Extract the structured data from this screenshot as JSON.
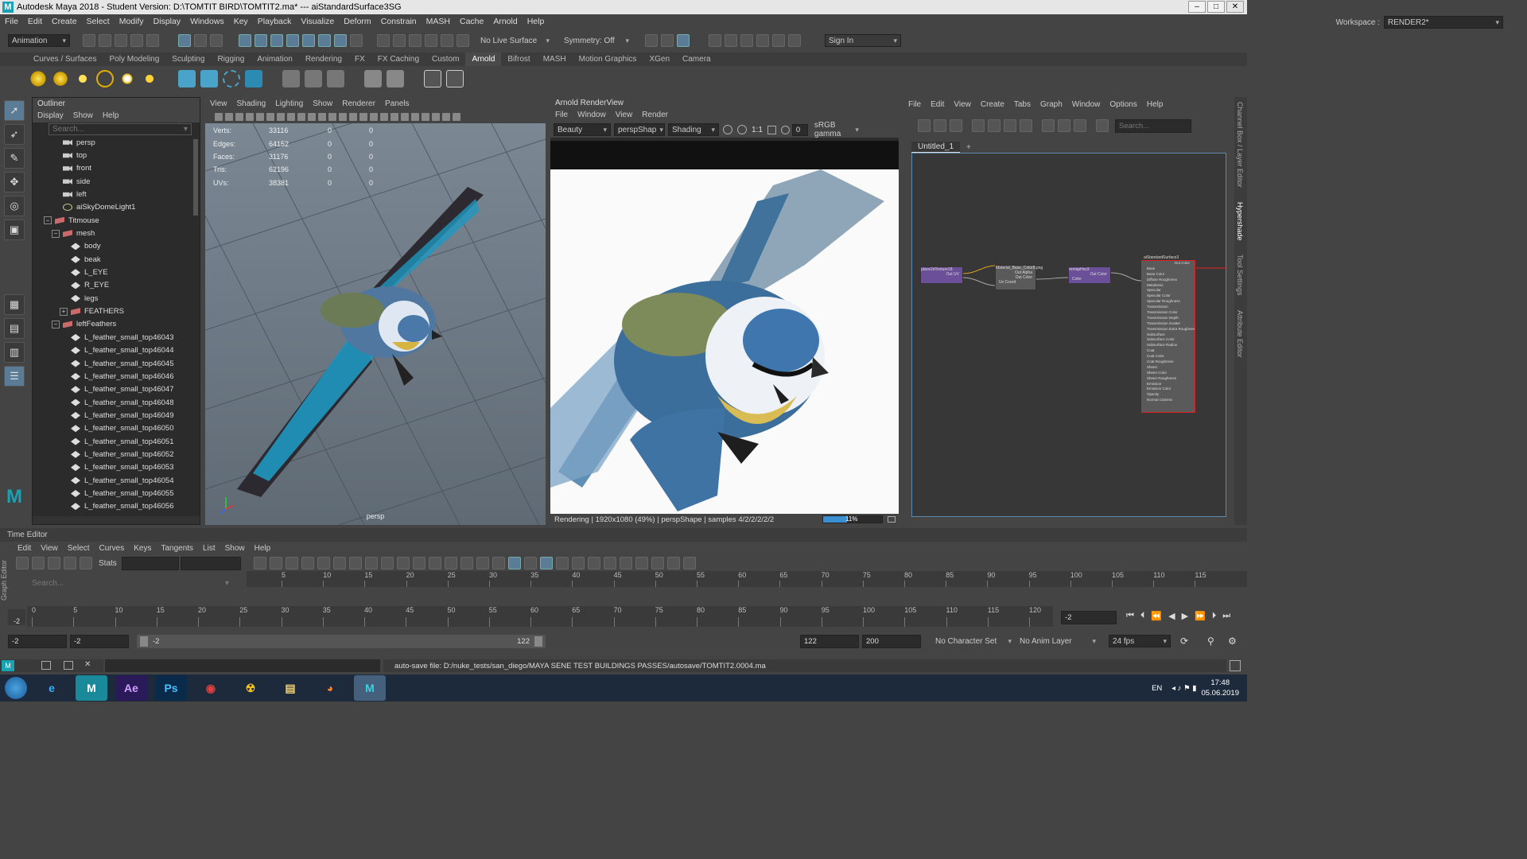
{
  "window": {
    "title": "Autodesk Maya 2018 - Student Version: D:\\TOMTIT BIRD\\TOMTIT2.ma*   ---   aiStandardSurface3SG",
    "min": "–",
    "max": "□",
    "close": "✕"
  },
  "menubar": [
    "File",
    "Edit",
    "Create",
    "Select",
    "Modify",
    "Display",
    "Windows",
    "Key",
    "Playback",
    "Visualize",
    "Deform",
    "Constrain",
    "MASH",
    "Cache",
    "Arnold",
    "Help"
  ],
  "workspace": {
    "label": "Workspace :",
    "value": "RENDER2*"
  },
  "statusline": {
    "mode": "Animation",
    "live_surface": "No Live Surface",
    "symmetry": "Symmetry: Off",
    "sign_in": "Sign In"
  },
  "shelf_tabs": [
    "Curves / Surfaces",
    "Poly Modeling",
    "Sculpting",
    "Rigging",
    "Animation",
    "Rendering",
    "FX",
    "FX Caching",
    "Custom",
    "Arnold",
    "Bifrost",
    "MASH",
    "Motion Graphics",
    "XGen",
    "Camera"
  ],
  "shelf_active": "Arnold",
  "outliner": {
    "title": "Outliner",
    "menu": [
      "Display",
      "Show",
      "Help"
    ],
    "search_placeholder": "Search...",
    "rows": [
      {
        "label": "persp",
        "icon": "camera-icon",
        "indent": 24
      },
      {
        "label": "top",
        "icon": "camera-icon",
        "indent": 24
      },
      {
        "label": "front",
        "icon": "camera-icon",
        "indent": 24
      },
      {
        "label": "side",
        "icon": "camera-icon",
        "indent": 24
      },
      {
        "label": "left",
        "icon": "camera-icon",
        "indent": 24
      },
      {
        "label": "aiSkyDomeLight1",
        "icon": "light-icon",
        "indent": 24
      },
      {
        "label": "Titmouse",
        "icon": "group-icon",
        "indent": 14,
        "exp": "−"
      },
      {
        "label": "mesh",
        "icon": "group-icon",
        "indent": 24,
        "exp": "−"
      },
      {
        "label": "body",
        "icon": "mesh-icon",
        "indent": 34
      },
      {
        "label": "beak",
        "icon": "mesh-icon",
        "indent": 34
      },
      {
        "label": "L_EYE",
        "icon": "mesh-icon",
        "indent": 34
      },
      {
        "label": "R_EYE",
        "icon": "mesh-icon",
        "indent": 34
      },
      {
        "label": "legs",
        "icon": "mesh-icon",
        "indent": 34
      },
      {
        "label": "FEATHERS",
        "icon": "group-icon",
        "indent": 34,
        "exp": "+"
      },
      {
        "label": "leftFeathers",
        "icon": "group-icon",
        "indent": 24,
        "exp": "−"
      },
      {
        "label": "L_feather_small_top46043",
        "icon": "mesh-icon",
        "indent": 34
      },
      {
        "label": "L_feather_small_top46044",
        "icon": "mesh-icon",
        "indent": 34
      },
      {
        "label": "L_feather_small_top46045",
        "icon": "mesh-icon",
        "indent": 34
      },
      {
        "label": "L_feather_small_top46046",
        "icon": "mesh-icon",
        "indent": 34
      },
      {
        "label": "L_feather_small_top46047",
        "icon": "mesh-icon",
        "indent": 34
      },
      {
        "label": "L_feather_small_top46048",
        "icon": "mesh-icon",
        "indent": 34
      },
      {
        "label": "L_feather_small_top46049",
        "icon": "mesh-icon",
        "indent": 34
      },
      {
        "label": "L_feather_small_top46050",
        "icon": "mesh-icon",
        "indent": 34
      },
      {
        "label": "L_feather_small_top46051",
        "icon": "mesh-icon",
        "indent": 34
      },
      {
        "label": "L_feather_small_top46052",
        "icon": "mesh-icon",
        "indent": 34
      },
      {
        "label": "L_feather_small_top46053",
        "icon": "mesh-icon",
        "indent": 34
      },
      {
        "label": "L_feather_small_top46054",
        "icon": "mesh-icon",
        "indent": 34
      },
      {
        "label": "L_feather_small_top46055",
        "icon": "mesh-icon",
        "indent": 34
      },
      {
        "label": "L_feather_small_top46056",
        "icon": "mesh-icon",
        "indent": 34
      }
    ]
  },
  "viewport": {
    "menu": [
      "View",
      "Shading",
      "Lighting",
      "Show",
      "Renderer",
      "Panels"
    ],
    "hud": [
      {
        "label": "Verts:",
        "v": "33116",
        "a": "0",
        "b": "0"
      },
      {
        "label": "Edges:",
        "v": "64152",
        "a": "0",
        "b": "0"
      },
      {
        "label": "Faces:",
        "v": "31176",
        "a": "0",
        "b": "0"
      },
      {
        "label": "Tris:",
        "v": "62196",
        "a": "0",
        "b": "0"
      },
      {
        "label": "UVs:",
        "v": "38381",
        "a": "0",
        "b": "0"
      }
    ],
    "camera": "persp"
  },
  "renderview": {
    "title": "Arnold RenderView",
    "menu": [
      "File",
      "Window",
      "View",
      "Render"
    ],
    "aov": "Beauty",
    "camera": "perspShap",
    "shading": "Shading",
    "ratio": "1:1",
    "exposure": "0",
    "colorspace": "sRGB gamma",
    "status": "Rendering | 1920x1080 (49%) | perspShape  | samples 4/2/2/2/2/2",
    "progress_label": "11%",
    "progress": 0.41
  },
  "hypershade": {
    "menu": [
      "File",
      "Edit",
      "View",
      "Create",
      "Tabs",
      "Graph",
      "Window",
      "Options",
      "Help"
    ],
    "search_placeholder": "Search...",
    "tab": "Untitled_1",
    "tab_add": "+",
    "nodes": [
      {
        "title": "place2dTexture18",
        "ports": [
          "Out UV"
        ]
      },
      {
        "title": "Material_Base_Color8.png",
        "ports": [
          "Out Alpha",
          "Out Color",
          "Uv Coord"
        ]
      },
      {
        "title": "remapHsv3",
        "ports": [
          "Color",
          "Out Color"
        ]
      },
      {
        "title": "aiStandardSurface3",
        "ports": [
          "Out Color",
          "Base",
          "Base Color",
          "Diffuse Roughness",
          "Metalness",
          "Specular",
          "Specular Color",
          "Specular Roughness",
          "Transmission",
          "Transmission Color",
          "Transmission Depth",
          "Transmission Scatter",
          "Transmission Extra Roughness",
          "Subsurface",
          "Subsurface Color",
          "Subsurface Radius",
          "Coat",
          "Coat Color",
          "Coat Roughness",
          "Sheen",
          "Sheen Color",
          "Sheen Roughness",
          "Emission",
          "Emission Color",
          "Opacity",
          "Normal Camera"
        ]
      }
    ]
  },
  "side_tabs": [
    "Channel Box / Layer Editor",
    "Hypershade",
    "Tool Settings",
    "Attribute Editor"
  ],
  "time_editor": "Time Editor",
  "graph_editor": {
    "side_label": "Graph Editor",
    "menu": [
      "Edit",
      "View",
      "Select",
      "Curves",
      "Keys",
      "Tangents",
      "List",
      "Show",
      "Help"
    ],
    "stats": "Stats",
    "search_placeholder": "Search...",
    "ruler": [
      "5",
      "10",
      "15",
      "20",
      "25",
      "30",
      "35",
      "40",
      "45",
      "50",
      "55",
      "60",
      "65",
      "70",
      "75",
      "80",
      "85",
      "90",
      "95",
      "100",
      "105",
      "110",
      "115"
    ]
  },
  "timeslider": {
    "ticks": [
      "0",
      "5",
      "10",
      "15",
      "20",
      "25",
      "30",
      "35",
      "40",
      "45",
      "50",
      "55",
      "60",
      "65",
      "70",
      "75",
      "80",
      "85",
      "90",
      "95",
      "100",
      "105",
      "110",
      "115",
      "120"
    ],
    "current_frame": "-2",
    "marker": "-2"
  },
  "range": {
    "start": "-2",
    "anim_start": "-2",
    "slider_start": "-2",
    "slider_end": "122",
    "anim_end": "122",
    "end": "200",
    "character_set": "No Character Set",
    "anim_layer": "No Anim Layer",
    "fps": "24 fps"
  },
  "cmdline": {
    "message": "auto-save file: D:/nuke_tests/san_diego/MAYA SENE TEST BUILDINGS PASSES/autosave/TOMTIT2.0004.ma"
  },
  "taskbar": {
    "apps": [
      "e",
      "M",
      "Ae",
      "Ps",
      "◉",
      "☢",
      "▤",
      "◕",
      "M"
    ],
    "lang": "EN",
    "time": "17:48",
    "date": "05.06.2019"
  },
  "colors": {
    "accent": "#5a7c96",
    "maya_teal": "#19a2b4",
    "node_selected": "#e02020"
  }
}
